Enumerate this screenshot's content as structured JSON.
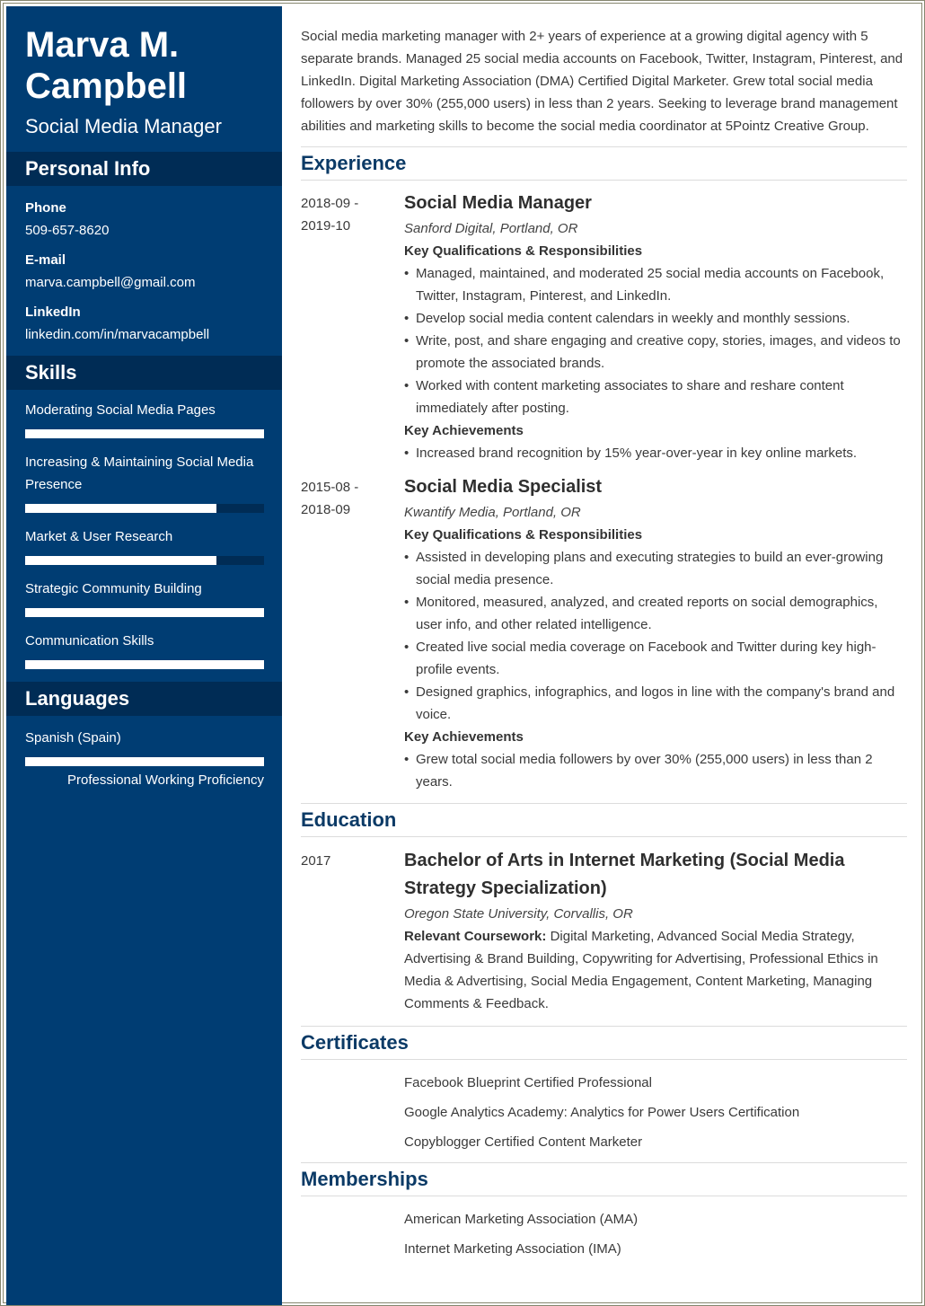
{
  "profile": {
    "name_line1": "Marva M.",
    "name_line2": "Campbell",
    "role": "Social Media Manager"
  },
  "personal_info": {
    "heading": "Personal Info",
    "items": [
      {
        "label": "Phone",
        "value": "509-657-8620"
      },
      {
        "label": "E-mail",
        "value": "marva.campbell@gmail.com"
      },
      {
        "label": "LinkedIn",
        "value": "linkedin.com/in/marvacampbell"
      }
    ]
  },
  "skills": {
    "heading": "Skills",
    "items": [
      {
        "name": "Moderating Social Media Pages",
        "level_percent": 100
      },
      {
        "name": "Increasing & Maintaining Social Media Presence",
        "level_percent": 80
      },
      {
        "name": "Market & User Research",
        "level_percent": 80
      },
      {
        "name": "Strategic Community Building",
        "level_percent": 100
      },
      {
        "name": "Communication Skills",
        "level_percent": 100
      }
    ]
  },
  "languages": {
    "heading": "Languages",
    "items": [
      {
        "name": "Spanish (Spain)",
        "level_percent": 100,
        "level_label": "Professional Working Proficiency"
      }
    ]
  },
  "summary": "Social media marketing manager with 2+ years of experience at a growing digital agency with 5 separate brands. Managed 25 social media accounts on Facebook, Twitter, Instagram, Pinterest, and LinkedIn. Digital Marketing Association (DMA) Certified Digital Marketer. Grew total social media followers by over 30% (255,000 users) in less than 2 years. Seeking to leverage brand management abilities and marketing skills to become the social media coordinator at 5Pointz Creative Group.",
  "experience": {
    "heading": "Experience",
    "jobs": [
      {
        "date_start": "2018-09 -",
        "date_end": "2019-10",
        "title": "Social Media Manager",
        "company": "Sanford Digital, Portland, OR",
        "resp_heading": "Key Qualifications & Responsibilities",
        "responsibilities": [
          "Managed, maintained, and moderated 25 social media accounts on Facebook, Twitter, Instagram, Pinterest, and LinkedIn.",
          "Develop social media content calendars in weekly and monthly sessions.",
          "Write, post, and share engaging and creative copy, stories, images, and videos to promote the associated brands.",
          "Worked with content marketing associates to share and reshare content immediately after posting."
        ],
        "ach_heading": "Key Achievements",
        "achievements": [
          "Increased brand recognition by 15% year-over-year in key online markets."
        ]
      },
      {
        "date_start": "2015-08 -",
        "date_end": "2018-09",
        "title": "Social Media Specialist",
        "company": "Kwantify Media, Portland, OR",
        "resp_heading": "Key Qualifications & Responsibilities",
        "responsibilities": [
          "Assisted in developing plans and executing strategies to build an ever-growing social media presence.",
          "Monitored, measured, analyzed, and created reports on social demographics, user info, and other related intelligence.",
          "Created live social media coverage on Facebook and Twitter during key high-profile events.",
          "Designed graphics, infographics, and logos in line with the company's brand and voice."
        ],
        "ach_heading": "Key Achievements",
        "achievements": [
          "Grew total social media followers by over 30% (255,000 users) in less than 2 years."
        ]
      }
    ]
  },
  "education": {
    "heading": "Education",
    "items": [
      {
        "year": "2017",
        "degree": "Bachelor of Arts in Internet Marketing (Social Media Strategy Specialization)",
        "school": "Oregon State University, Corvallis, OR",
        "coursework_label": "Relevant Coursework:",
        "coursework": "Digital Marketing, Advanced Social Media Strategy, Advertising & Brand Building, Copywriting for Advertising, Professional Ethics in Media & Advertising, Social Media Engagement, Content Marketing, Managing Comments & Feedback."
      }
    ]
  },
  "certificates": {
    "heading": "Certificates",
    "items": [
      "Facebook Blueprint Certified Professional",
      "Google Analytics Academy: Analytics for Power Users Certification",
      "Copyblogger Certified Content Marketer"
    ]
  },
  "memberships": {
    "heading": "Memberships",
    "items": [
      "American Marketing Association (AMA)",
      "Internet Marketing Association (IMA)"
    ]
  },
  "colors": {
    "sidebar": "#003d73",
    "sidebar_header": "#002c55",
    "heading_text": "#0b3a66",
    "frame_border": "#86866f"
  }
}
